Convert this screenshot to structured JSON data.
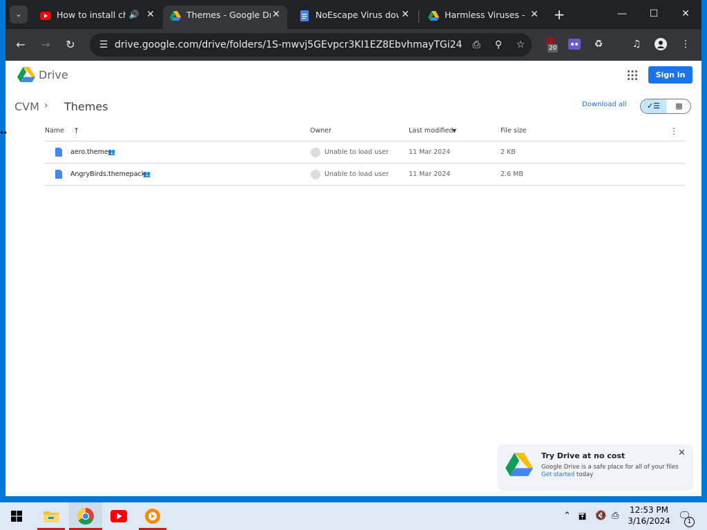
{
  "browser": {
    "tabs": [
      {
        "title": "How to install chr",
        "icon": "youtube-icon"
      },
      {
        "title": "Themes - Google Driv",
        "icon": "google-drive-icon",
        "active": true
      },
      {
        "title": "NoEscape Virus down",
        "icon": "google-docs-icon"
      },
      {
        "title": "Harmless Viruses - Go",
        "icon": "google-drive-icon"
      }
    ],
    "url": "drive.google.com/drive/folders/1S-mwvj5GEvpcr3KI1EZ8EbvhmayTGi24",
    "extension_badge": "20"
  },
  "drive": {
    "app_name": "Drive",
    "sign_in": "Sign in",
    "breadcrumb": [
      "CVM",
      "Themes"
    ],
    "download_all": "Download all",
    "columns": {
      "name": "Name",
      "owner": "Owner",
      "modified": "Last modified",
      "size": "File size"
    },
    "files": [
      {
        "name": "aero.theme",
        "owner": "Unable to load user",
        "modified": "11 Mar 2024",
        "size": "2 KB"
      },
      {
        "name": "AngryBirds.themepack",
        "owner": "Unable to load user",
        "modified": "11 Mar 2024",
        "size": "2.6 MB"
      }
    ],
    "promo": {
      "title": "Try Drive at no cost",
      "body": "Google Drive is a safe place for all of your files",
      "link": "Get started",
      "suffix": " today"
    }
  },
  "taskbar": {
    "time": "12:53 PM",
    "date": "3/16/2024",
    "notification_count": "1"
  },
  "colors": {
    "accent": "#1a73e8",
    "chrome_dark": "#202124",
    "taskbar": "#dfe9f5"
  }
}
